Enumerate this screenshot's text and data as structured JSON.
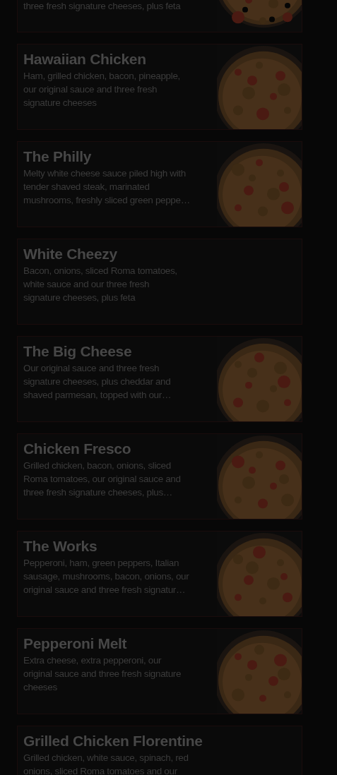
{
  "menu_items": [
    {
      "description": [
        "three fresh signature cheeses, plus feta"
      ],
      "has_picture": true,
      "cut_top": true
    },
    {
      "title": "Hawaiian Chicken",
      "description": [
        "Ham, grilled chicken, bacon, pineapple,",
        "our original sauce and three fresh",
        "signature cheeses"
      ],
      "has_picture": true
    },
    {
      "title": "The Philly",
      "description": [
        "Melty white cheese sauce piled high with",
        "tender shaved steak, marinated",
        "mushrooms, freshly sliced green peppe…"
      ],
      "has_picture": true
    },
    {
      "title": "White Cheezy",
      "description": [
        "Bacon, onions, sliced Roma tomatoes,",
        "white sauce and our three fresh",
        "signature cheeses, plus feta"
      ],
      "has_picture": false
    },
    {
      "title": "The Big Cheese",
      "description": [
        "Our original sauce and three fresh",
        "signature cheeses, plus cheddar and",
        "shaved parmesan, topped with our…"
      ],
      "has_picture": true
    },
    {
      "title": "Chicken Fresco",
      "description": [
        "Grilled chicken, bacon, onions, sliced",
        "Roma tomatoes, our original sauce and",
        "three fresh signature cheeses, plus…"
      ],
      "has_picture": true
    },
    {
      "title": "The Works",
      "description": [
        "Pepperoni, ham, green peppers, Italian",
        "sausage, mushrooms, bacon, onions, our",
        "original sauce and three fresh signatur…"
      ],
      "has_picture": true
    },
    {
      "title": "Pepperoni Melt",
      "description": [
        "Extra cheese, extra pepperoni, our",
        "original sauce and three fresh signature",
        "cheeses"
      ],
      "has_picture": true
    },
    {
      "title": "Grilled Chicken Florentine",
      "description": [
        "Grilled chicken, white sauce, spinach, red",
        "onions, sliced Roma tomatoes and our"
      ],
      "has_picture": false
    }
  ]
}
